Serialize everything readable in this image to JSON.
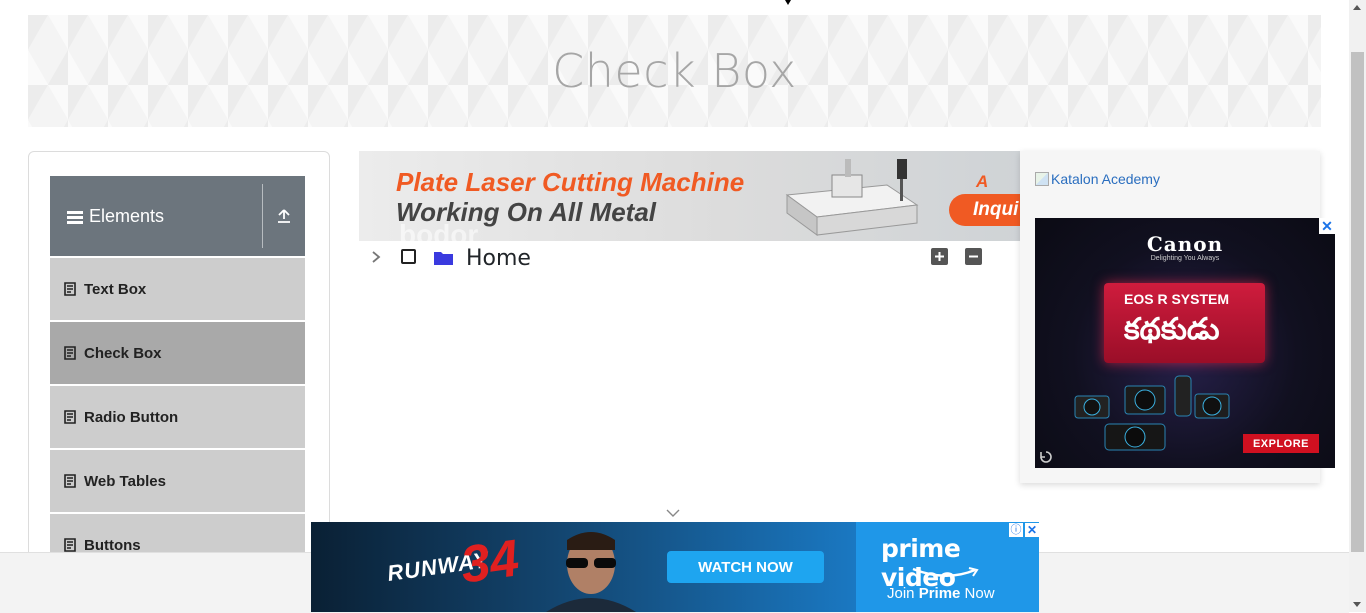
{
  "page": {
    "title": "Check Box"
  },
  "sidebar": {
    "group_label": "Elements",
    "items": [
      {
        "label": "Text Box",
        "active": false
      },
      {
        "label": "Check Box",
        "active": true
      },
      {
        "label": "Radio Button",
        "active": false
      },
      {
        "label": "Web Tables",
        "active": false
      },
      {
        "label": "Buttons",
        "active": false
      }
    ]
  },
  "tree": {
    "root_label": "Home",
    "checked": false,
    "expanded": false
  },
  "ads": {
    "top_banner": {
      "line1": "Plate Laser Cutting Machine",
      "line2": "Working On All Metal",
      "series_text": "A seri",
      "inquiry_text": "Inqui",
      "watermark": "bodor"
    },
    "side": {
      "alt_text": "Katalon Acedemy",
      "brand": "Canon",
      "tagline": "Delighting You Always",
      "system": "EOS R SYSTEM",
      "title": "కథకుడు",
      "cta": "EXPLORE"
    },
    "bottom": {
      "movie_word": "RUNWAY",
      "movie_number": "34",
      "cta": "WATCH NOW",
      "brand": "prime video",
      "join_prefix": "Join ",
      "join_brand": "Prime",
      "join_suffix": " Now"
    }
  },
  "colors": {
    "accent": "#6c757d",
    "active_item": "#a9a9a9",
    "item_bg": "#cdcdcd",
    "folder": "#3a3adf"
  }
}
